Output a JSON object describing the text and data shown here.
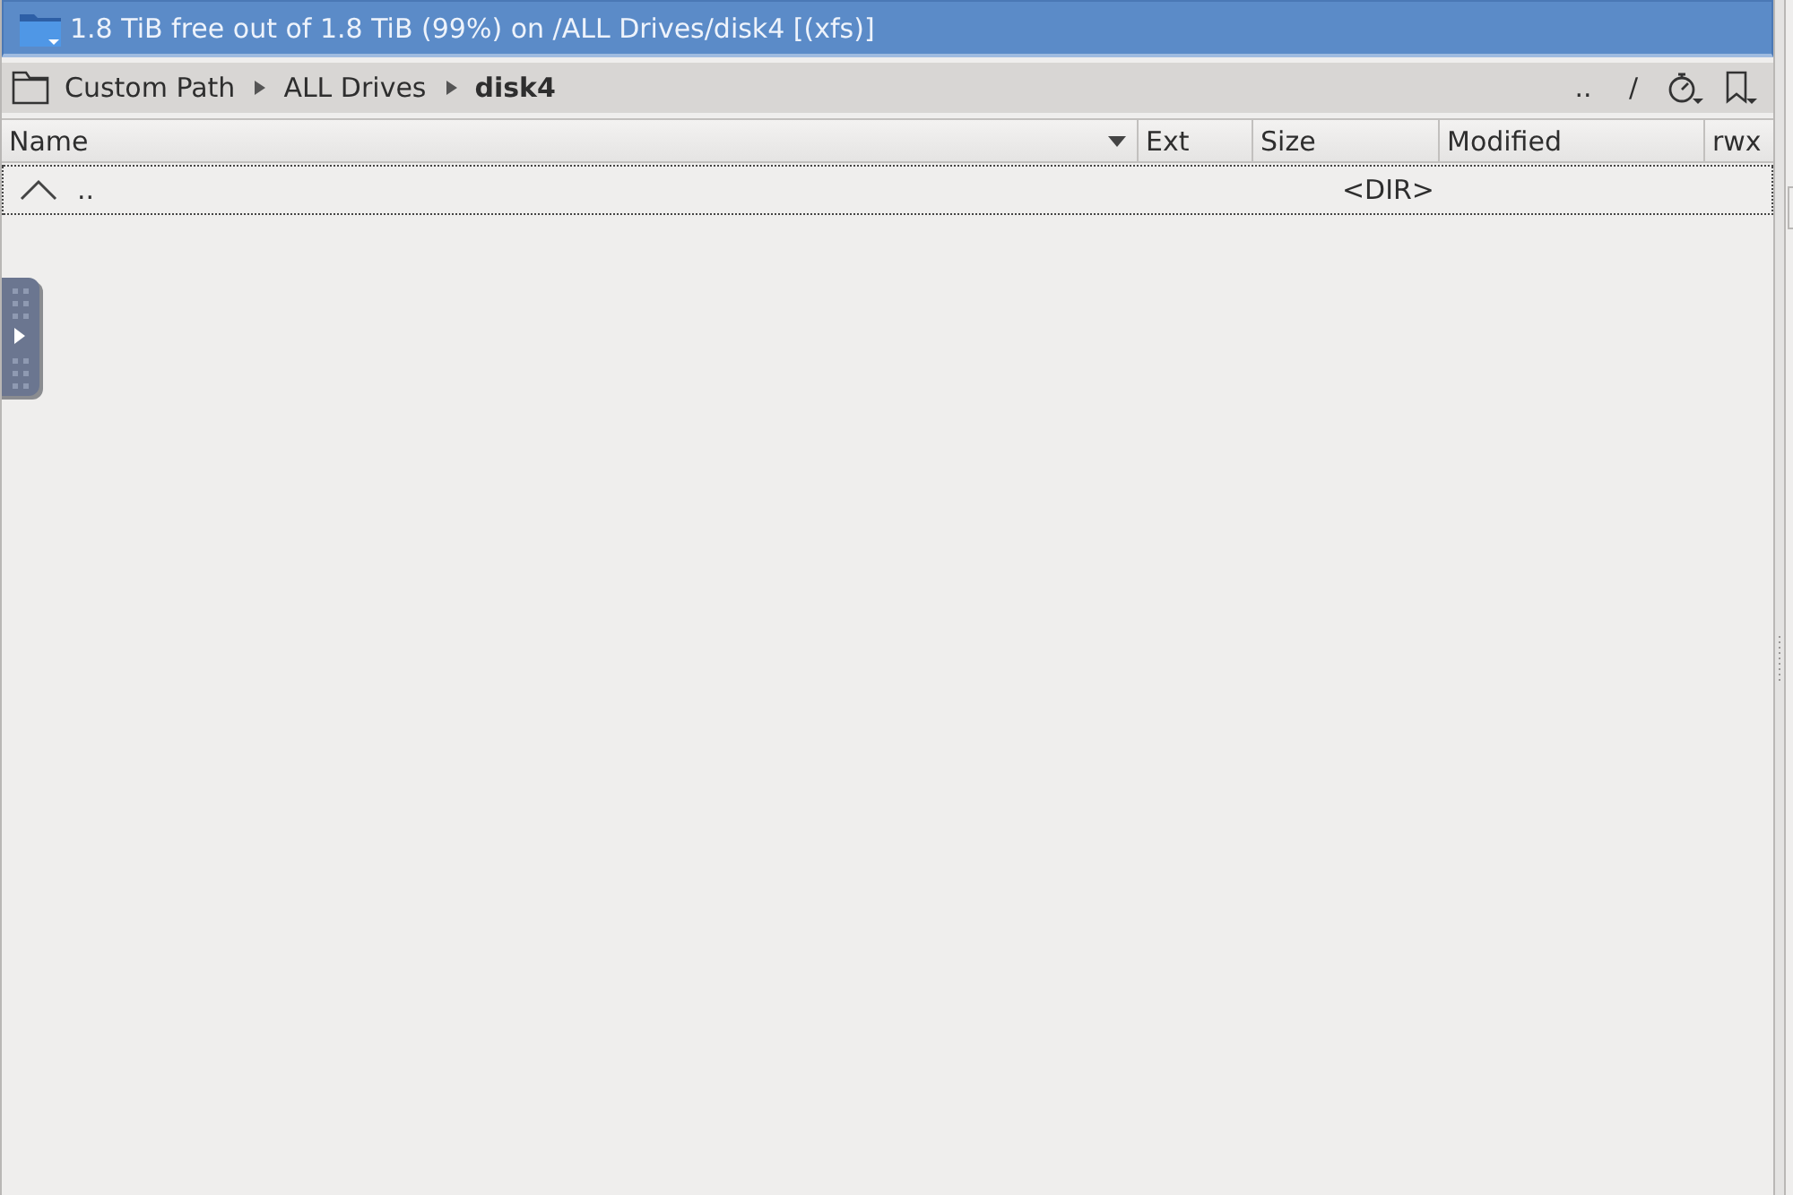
{
  "status_bar": {
    "text": "1.8 TiB free out of 1.8 TiB (99%) on /ALL Drives/disk4 [(xfs)]"
  },
  "breadcrumb": [
    {
      "label": "Custom Path",
      "current": false
    },
    {
      "label": "ALL Drives",
      "current": false
    },
    {
      "label": "disk4",
      "current": true
    }
  ],
  "toolbar": [
    {
      "kind": "text",
      "label": ".."
    },
    {
      "kind": "text",
      "label": "/"
    },
    {
      "kind": "history"
    },
    {
      "kind": "bookmarks"
    }
  ],
  "table": {
    "columns": [
      {
        "label": "Name",
        "sorted": true
      },
      {
        "label": "Ext",
        "sorted": false
      },
      {
        "label": "Size",
        "sorted": false
      },
      {
        "label": "Modified",
        "sorted": false
      },
      {
        "label": "rwx",
        "sorted": false
      }
    ],
    "rows": [
      {
        "name": "..",
        "size": "<DIR>",
        "focused": true
      }
    ]
  }
}
